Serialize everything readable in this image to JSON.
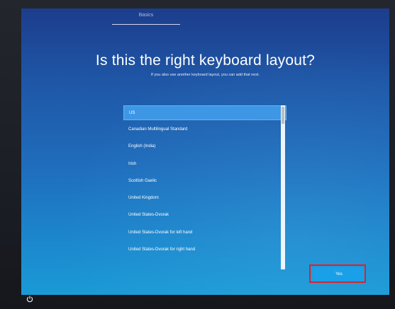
{
  "step_tab": {
    "label": "Basics"
  },
  "heading": {
    "title": "Is this the right keyboard layout?",
    "subtitle": "If you also use another keyboard layout, you can add that next."
  },
  "layout_list": {
    "selected": "US",
    "items": [
      "US",
      "Canadian Multilingual Standard",
      "English (India)",
      "Irish",
      "Scottish Gaelic",
      "United Kingdom",
      "United States-Dvorak",
      "United States-Dvorak for left hand",
      "United States-Dvorak for right hand"
    ]
  },
  "actions": {
    "yes_label": "Yes"
  },
  "icons": {
    "power": "power-icon"
  },
  "colors": {
    "selection": "#3d97e5",
    "primary_button": "#1aa0e8",
    "highlight": "#e0202a"
  }
}
